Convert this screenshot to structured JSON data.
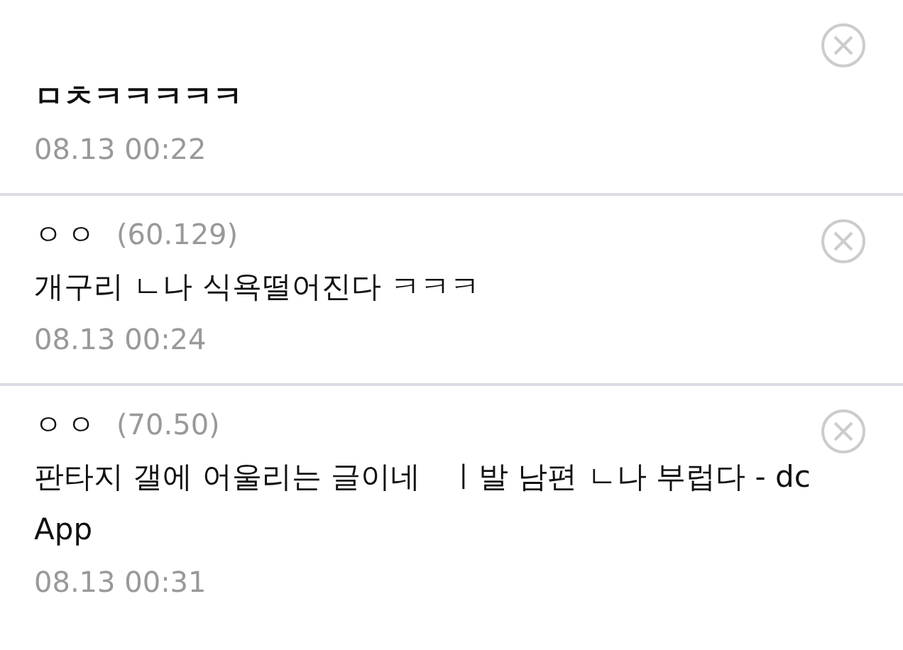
{
  "comments": [
    {
      "text": "ㅁㅊㅋㅋㅋㅋㅋ",
      "time": "08.13 00:22"
    },
    {
      "author": "ㅇㅇ",
      "ip": "(60.129)",
      "text": "개구리 ㄴ나 식욕떨어진다 ㅋㅋㅋ",
      "time": "08.13 00:24"
    },
    {
      "author": "ㅇㅇ",
      "ip": "(70.50)",
      "text": "판타지 갤에 어울리는 글이네   ㅣ발 남편 ㄴ나 부럽다 - dc App",
      "time": "08.13 00:31"
    }
  ]
}
